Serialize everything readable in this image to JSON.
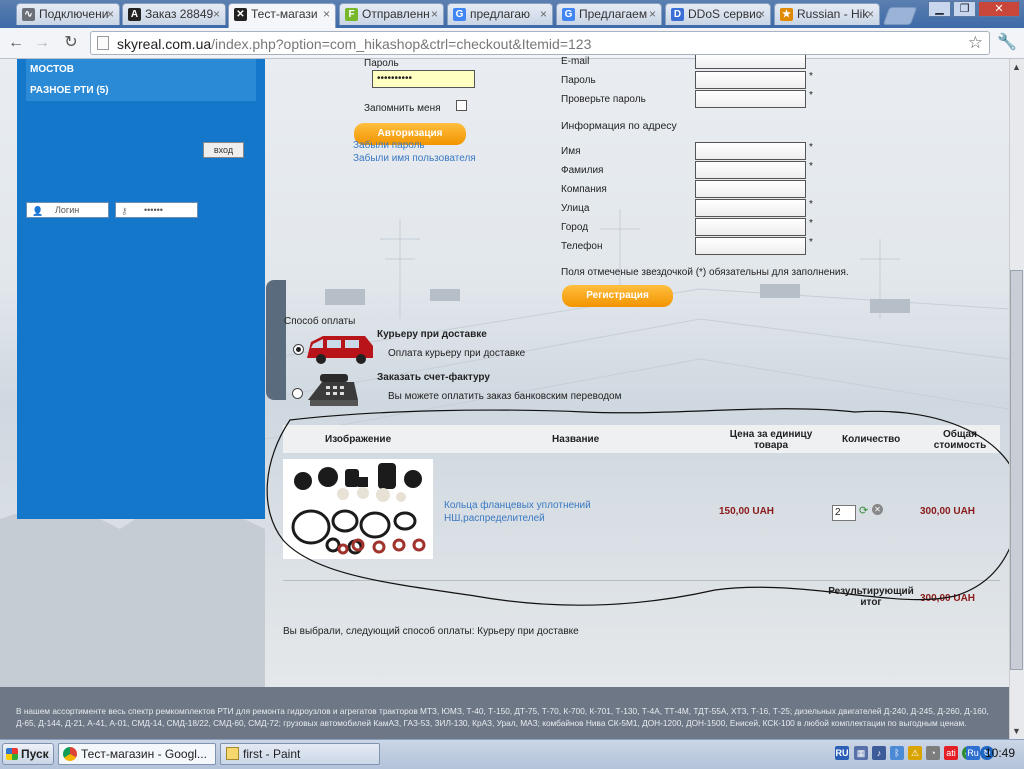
{
  "browser": {
    "tabs": [
      {
        "label": "Подключени",
        "color": "#6a6f78"
      },
      {
        "label": "Заказ 28849",
        "color": "#222222"
      },
      {
        "label": "Тест-магази",
        "color": "#222222",
        "active": true
      },
      {
        "label": "Отправленн",
        "color": "#76b82a"
      },
      {
        "label": "предлагаю",
        "color": "#4285f4"
      },
      {
        "label": "Предлагаем",
        "color": "#4285f4"
      },
      {
        "label": "DDoS сервис",
        "color": "#3a6fd8"
      },
      {
        "label": "Russian - Hik",
        "color": "#e08a00"
      }
    ],
    "tab_icons": [
      "",
      "A",
      "",
      "F",
      "G",
      "G",
      "D",
      "★"
    ],
    "url_host": "skyreal.com.ua",
    "url_rest": "/index.php?option=com_hikashop&ctrl=checkout&Itemid=123",
    "win_min": "▁",
    "win_max": "❐",
    "win_close": "✕"
  },
  "sidebar": {
    "categories": [
      "МОСТОВ",
      "РАЗНОЕ РТИ (5)"
    ],
    "login_placeholder": "Логин",
    "password_mask": "••••••",
    "login_button": "вход"
  },
  "login_form": {
    "password_label": "Пароль",
    "password_value": "••••••••••",
    "remember_label": "Запомнить меня",
    "auth_button": "Авторизация",
    "forgot_password": "Забыли пароль",
    "forgot_username": "Забыли имя пользователя"
  },
  "registration": {
    "email_label": "E-mail",
    "password_label": "Пароль",
    "confirm_label": "Проверьте пароль",
    "address_heading": "Информация по адресу",
    "name_label": "Имя",
    "surname_label": "Фамилия",
    "company_label": "Компания",
    "street_label": "Улица",
    "city_label": "Город",
    "phone_label": "Телефон",
    "required_note": "Поля отмеченые звездочкой (*) обязательны для заполнения.",
    "register_button": "Регистрация",
    "asterisk": "*"
  },
  "payment": {
    "heading": "Способ оплаты",
    "option1_title": "Курьеру при доставке",
    "option1_desc": "Оплата курьеру при доставке",
    "option2_title": "Заказать счет-фактуру",
    "option2_desc": "Вы можете оплатить заказ банковским переводом"
  },
  "cart": {
    "headers": {
      "image": "Изображение",
      "name": "Название",
      "unit_price": "Цена за единицу товара",
      "quantity": "Количество",
      "total": "Общая стоимость"
    },
    "item": {
      "name": "Кольца фланцевых уплотнений НШ,распределителей",
      "unit_price": "150,00 UAH",
      "quantity": "2",
      "total": "300,00 UAH"
    },
    "summary_label": "Результирующий итог",
    "summary_value": "300,00 UAH",
    "chosen_payment": "Вы выбрали, следующий способ оплаты: Курьеру при доставке"
  },
  "footer": {
    "text": "В нашем ассортименте весь спектр ремкомплектов РТИ для ремонта гидроузлов и агрегатов тракторов МТЗ, ЮМЗ, Т-40, Т-150, ДТ-75, Т-70, К-700, К-701, Т-130, Т-4А, ТТ-4М, ТДТ-55А, ХТЗ, Т-16, Т-25; дизельных двигателей Д-240, Д-245, Д-260, Д-160, Д-65, Д-144, Д-21, А-41, А-01, СМД-14, СМД-18/22, СМД-60, СМД-72; грузовых автомобилей КамАЗ, ГАЗ-53, ЗИЛ-130, КрАЗ, Урал, МАЗ; комбайнов Нива СК-5М1, ДОН-1200, ДОН-1500, Енисей, КСК-100 в любой комплектации по выгодным ценам."
  },
  "taskbar": {
    "start": "Пуск",
    "task1": "Тест-магазин - Googl...",
    "task2": "first - Paint",
    "lang": "RU",
    "lang2": "Ru",
    "clock": "10:49"
  }
}
